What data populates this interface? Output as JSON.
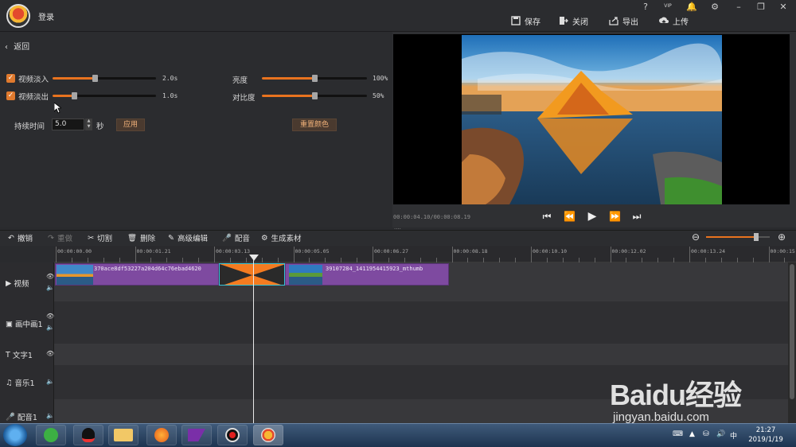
{
  "header": {
    "login": "登录",
    "window_icons": [
      "?",
      "VIP",
      "🔔",
      "⚙",
      "–",
      "❐",
      "✕"
    ],
    "actions": [
      {
        "label": "保存",
        "icon": "save-icon"
      },
      {
        "label": "关闭",
        "icon": "exit-icon"
      },
      {
        "label": "导出",
        "icon": "export-icon"
      },
      {
        "label": "上传",
        "icon": "upload-icon"
      }
    ]
  },
  "editor": {
    "back_label": "返回",
    "fade_in": {
      "label": "视频淡入",
      "checked": true,
      "value": "2.0s",
      "level": 0.4
    },
    "fade_out": {
      "label": "视频淡出",
      "checked": true,
      "value": "1.0s",
      "level": 0.2
    },
    "brightness": {
      "label": "亮度",
      "value": "100%",
      "level": 0.5
    },
    "contrast": {
      "label": "对比度",
      "value": "50%",
      "level": 0.5
    },
    "duration": {
      "label": "持续时间",
      "value": "5.0",
      "unit": "秒"
    },
    "apply_label": "应用",
    "reset_color_label": "重置颜色"
  },
  "preview": {
    "timecode": "00:00:04.10/00:00:08.19",
    "controls": [
      "skip-start-icon",
      "step-back-icon",
      "play-icon",
      "step-forward-icon",
      "skip-end-icon"
    ]
  },
  "toolbar": {
    "undo": "撤销",
    "redo": "重做",
    "cut": "切割",
    "delete": "删除",
    "advanced_edit": "高级编辑",
    "dub": "配音",
    "generate_material": "生成素材",
    "zoom_level": 0.79
  },
  "timeline": {
    "ticks": [
      "00:00:00.00",
      "00:00:01.21",
      "00:00:03.13",
      "00:00:05.05",
      "00:00:06.27",
      "00:00:08.18",
      "00:00:10.10",
      "00:00:12.02",
      "00:00:13.24",
      "00:00:15"
    ],
    "tracks": [
      {
        "label": "视频",
        "icon": "play-square-icon"
      },
      {
        "label": "画中画1",
        "icon": "pip-icon"
      },
      {
        "label": "文字1",
        "icon": "text-icon"
      },
      {
        "label": "音乐1",
        "icon": "music-icon"
      },
      {
        "label": "配音1",
        "icon": "mic-icon"
      }
    ],
    "clips": [
      {
        "name": "370ace8df53227a204d64c76ebad4620"
      },
      {
        "name": "39107284_1411954415923_mthumb"
      }
    ]
  },
  "taskbar": {
    "time": "21:27",
    "date": "2019/1/19"
  },
  "watermark": {
    "brand": "Baidu经验",
    "url": "jingyan.baidu.com"
  }
}
